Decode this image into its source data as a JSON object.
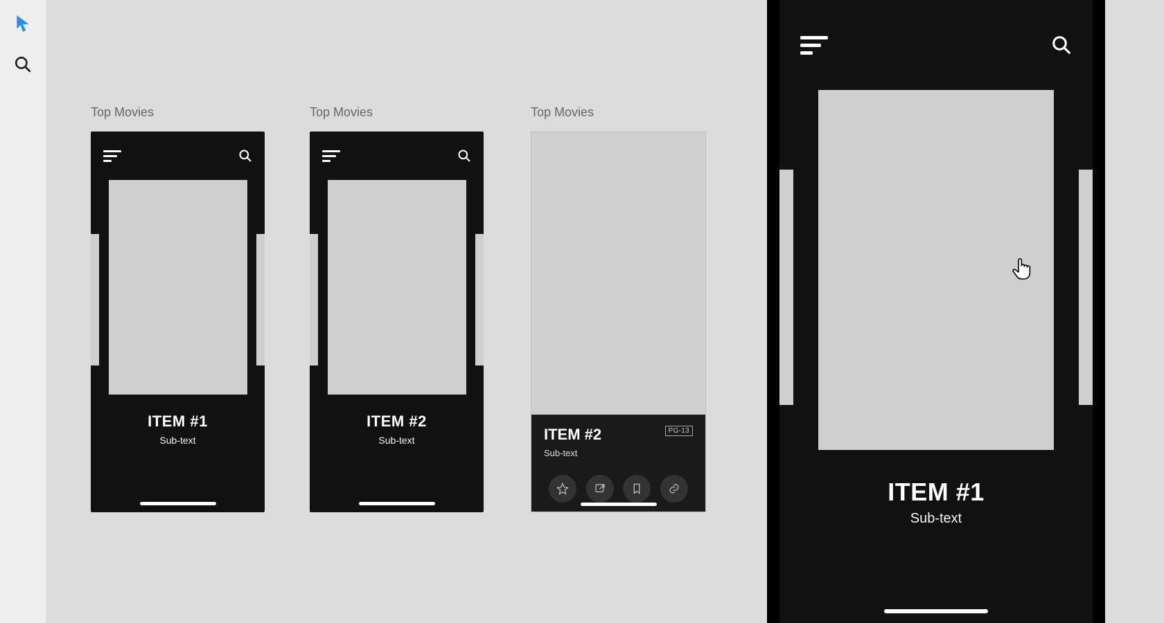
{
  "artboards": [
    {
      "label": "Top Movies",
      "item_title": "ITEM #1",
      "item_sub": "Sub-text"
    },
    {
      "label": "Top Movies",
      "item_title": "ITEM #2",
      "item_sub": "Sub-text"
    },
    {
      "label": "Top Movies",
      "detail_title": "ITEM #2",
      "detail_sub": "Sub-text",
      "rating": "PG-13"
    }
  ],
  "preview": {
    "item_title": "ITEM #1",
    "item_sub": "Sub-text"
  },
  "icons": {
    "pointer": "pointer-icon",
    "search": "search-icon",
    "menu": "menu-icon",
    "star": "star-icon",
    "share": "share-icon",
    "bookmark": "bookmark-icon",
    "link": "link-icon"
  }
}
